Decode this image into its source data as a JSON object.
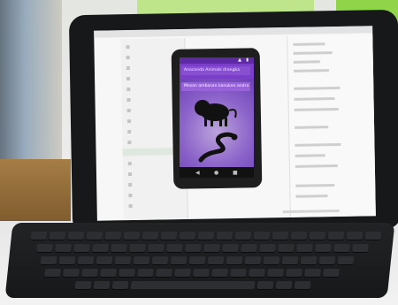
{
  "scene": {
    "description_tag": "Tablet with keyboard displaying an app builder preview"
  },
  "phone_app": {
    "input_primary": "Anaconda Animals drangka",
    "input_secondary": "Mosan ambasan kanukan andra",
    "animal_top_icon": "lion-icon",
    "animal_bottom_icon": "snake-icon"
  },
  "navigation_icons": {
    "back": "◀",
    "home": "●",
    "recents": "■"
  },
  "status_icons": {
    "signal": "▲",
    "battery": "▮"
  }
}
